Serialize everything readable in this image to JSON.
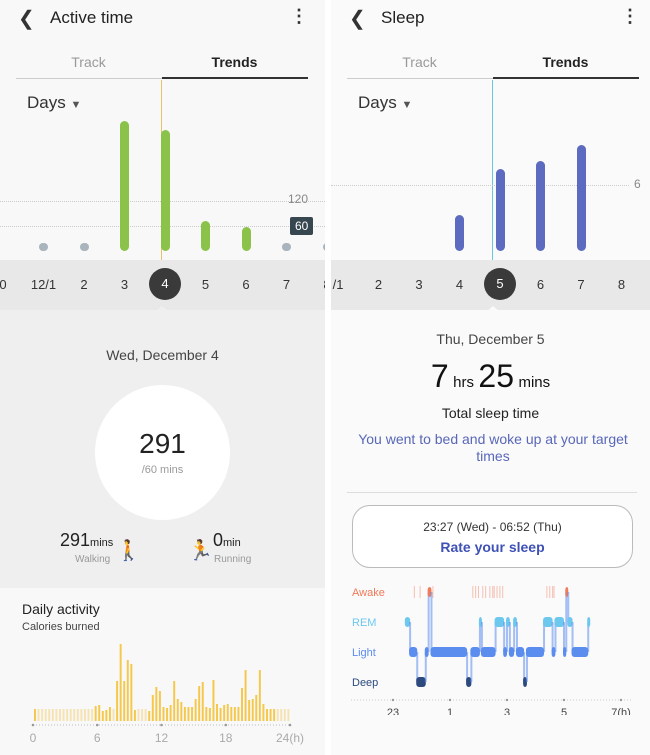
{
  "left": {
    "title": "Active time",
    "tabs": [
      "Track",
      "Trends"
    ],
    "active_tab": "Trends",
    "period": "Days",
    "chart": {
      "type": "bar",
      "categories": [
        "0",
        "12/1",
        "2",
        "3",
        "4",
        "5",
        "6",
        "7",
        "8"
      ],
      "values": [
        null,
        5,
        15,
        312,
        291,
        72,
        58,
        10,
        5
      ],
      "goal_met": [
        false,
        false,
        false,
        true,
        true,
        true,
        true,
        false,
        false
      ],
      "gridlines": [
        120,
        60
      ],
      "goal_label": "60",
      "selected": "4",
      "unit": "mins"
    },
    "date": "Wed, December 4",
    "total": "291",
    "goal": "/60 mins",
    "walking": {
      "value": "291",
      "unit": "mins",
      "label": "Walking"
    },
    "running": {
      "value": "0",
      "unit": "min",
      "label": "Running"
    },
    "daily": {
      "title": "Daily activity",
      "subtitle": "Calories burned",
      "x_ticks": [
        "0",
        "6",
        "12",
        "18",
        "24(h)"
      ],
      "values": [
        12,
        0,
        0,
        0,
        0,
        0,
        0,
        0,
        0,
        0,
        0,
        0,
        0,
        0,
        0,
        0,
        0,
        15,
        16,
        10,
        11,
        14,
        0,
        40,
        77,
        40,
        61,
        57,
        11,
        0,
        0,
        0,
        10,
        26,
        34,
        30,
        14,
        13,
        16,
        40,
        22,
        19,
        14,
        14,
        14,
        22,
        35,
        39,
        14,
        13,
        41,
        17,
        13,
        16,
        17,
        14,
        14,
        14,
        33,
        51,
        21,
        22,
        26,
        51,
        17,
        12,
        12,
        12,
        0,
        0,
        0,
        0
      ]
    },
    "colors": {
      "active": "#8bc34a",
      "inactive": "#a9b4bc",
      "calories": "#f5c84c",
      "calories_empty": "#f6e3b4"
    }
  },
  "right": {
    "title": "Sleep",
    "tabs": [
      "Track",
      "Trends"
    ],
    "active_tab": "Trends",
    "period": "Days",
    "chart": {
      "type": "bar",
      "categories": [
        "/1",
        "2",
        "3",
        "4",
        "5",
        "6",
        "7",
        "8"
      ],
      "values": [
        null,
        null,
        null,
        3.3,
        7.42,
        8.2,
        9.6,
        null
      ],
      "gridline": 6,
      "selected": "5",
      "unit": "hrs"
    },
    "date": "Thu, December 5",
    "hrs": "7",
    "hrs_unit": "hrs",
    "mins": "25",
    "mins_unit": "mins",
    "total_label": "Total sleep time",
    "message": "You went to bed and woke up at your target times",
    "range": "23:27 (Wed) - 06:52 (Thu)",
    "rate_label": "Rate your sleep",
    "stages": [
      "Awake",
      "REM",
      "Light",
      "Deep"
    ],
    "x_ticks": [
      "23",
      "1",
      "3",
      "5",
      "7(h)"
    ],
    "hypnogram": [
      [
        23.45,
        23.6,
        "REM"
      ],
      [
        23.6,
        23.85,
        "Light"
      ],
      [
        23.85,
        24.15,
        "Deep"
      ],
      [
        24.15,
        24.25,
        "Light"
      ],
      [
        24.25,
        24.35,
        "Awake"
      ],
      [
        24.35,
        25.6,
        "Light"
      ],
      [
        25.6,
        25.75,
        "Deep"
      ],
      [
        25.75,
        26.05,
        "Light"
      ],
      [
        26.05,
        26.12,
        "REM"
      ],
      [
        26.12,
        26.6,
        "Light"
      ],
      [
        26.6,
        26.9,
        "REM"
      ],
      [
        26.9,
        27.0,
        "Light"
      ],
      [
        27.0,
        27.1,
        "REM"
      ],
      [
        27.1,
        27.25,
        "Light"
      ],
      [
        27.25,
        27.35,
        "REM"
      ],
      [
        27.35,
        27.6,
        "Light"
      ],
      [
        27.6,
        27.7,
        "Deep"
      ],
      [
        27.7,
        28.3,
        "Light"
      ],
      [
        28.3,
        28.6,
        "REM"
      ],
      [
        28.6,
        28.7,
        "Light"
      ],
      [
        28.7,
        29.0,
        "REM"
      ],
      [
        29.0,
        29.08,
        "Light"
      ],
      [
        29.08,
        29.15,
        "Awake"
      ],
      [
        29.15,
        29.3,
        "REM"
      ],
      [
        29.3,
        29.85,
        "Light"
      ],
      [
        29.85,
        29.9,
        "REM"
      ]
    ],
    "awake_ticks": [
      23.75,
      23.95,
      24.4,
      25.8,
      25.9,
      26.0,
      26.15,
      26.25,
      26.4,
      26.5,
      26.55,
      26.65,
      26.75,
      26.85,
      28.4,
      28.5,
      28.6,
      28.65
    ],
    "colors": {
      "bar": "#5c6bc0",
      "Awake": "#f07a5a",
      "REM": "#6dc8ee",
      "Light": "#5b8def",
      "Deep": "#2c4a7e",
      "message": "#5867b8",
      "rate": "#3f51b5"
    }
  }
}
